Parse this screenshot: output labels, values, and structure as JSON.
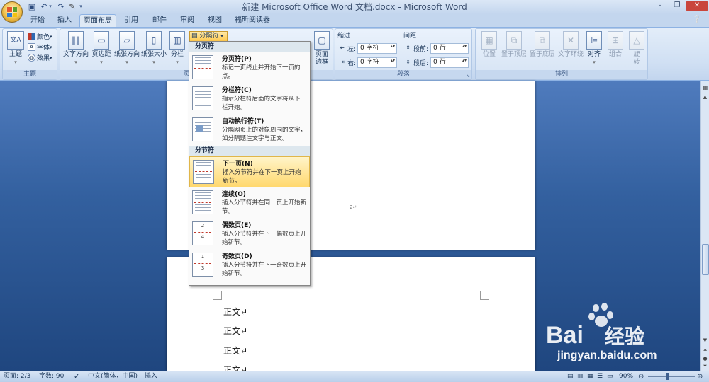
{
  "window": {
    "title": "新建 Microsoft Office Word 文档.docx - Microsoft Word",
    "controls": [
      "–",
      "❐",
      "✕"
    ]
  },
  "tabs": [
    {
      "label": "开始"
    },
    {
      "label": "插入"
    },
    {
      "label": "页面布局",
      "active": true
    },
    {
      "label": "引用"
    },
    {
      "label": "邮件"
    },
    {
      "label": "审阅"
    },
    {
      "label": "视图"
    },
    {
      "label": "福昕阅读器"
    }
  ],
  "ribbon": {
    "themes": {
      "label": "主题",
      "theme_button": "主题",
      "colors": "颜色",
      "fonts": "字体",
      "effects": "效果"
    },
    "page_setup": {
      "label": "页面设置",
      "text_direction": "文字方向",
      "margins": "页边距",
      "orientation": "纸张方向",
      "size": "纸张大小",
      "columns": "分栏",
      "breaks": "分隔符",
      "page_border": "页面边框"
    },
    "paragraph": {
      "label": "段落",
      "indent_title": "缩进",
      "spacing_title": "间距",
      "indent_left_label": "左:",
      "indent_left_value": "0 字符",
      "indent_right_label": "右:",
      "indent_right_value": "0 字符",
      "spacing_before_label": "段前:",
      "spacing_before_value": "0 行",
      "spacing_after_label": "段后:",
      "spacing_after_value": "0 行"
    },
    "arrange": {
      "label": "排列",
      "position": "位置",
      "bring_front": "置于顶层",
      "send_back": "置于底层",
      "text_wrap": "文字环绕",
      "align": "对齐",
      "group": "组合",
      "rotate": "旋转"
    }
  },
  "breaks_menu": {
    "page_breaks_header": "分页符",
    "section_breaks_header": "分节符",
    "items": [
      {
        "title": "分页符(P)",
        "desc": "标记一页终止并开始下一页的点。"
      },
      {
        "title": "分栏符(C)",
        "desc": "指示分栏符后面的文字将从下一栏开始。"
      },
      {
        "title": "自动换行符(T)",
        "desc": "分隔网页上的对象周围的文字，如分隔题注文字与正文。"
      },
      {
        "title": "下一页(N)",
        "desc": "插入分节符并在下一页上开始新节。",
        "highlighted": true
      },
      {
        "title": "连续(O)",
        "desc": "插入分节符并在同一页上开始新节。"
      },
      {
        "title": "偶数页(E)",
        "desc": "插入分节符并在下一偶数页上开始新节。",
        "icon_numbers": [
          "2",
          "4"
        ]
      },
      {
        "title": "奇数页(D)",
        "desc": "插入分节符并在下一奇数页上开始新节。",
        "icon_numbers": [
          "1",
          "3"
        ]
      }
    ]
  },
  "document": {
    "page_number_mark": "2↵",
    "paragraphs": [
      "正文↵",
      "正文↵",
      "正文↵",
      "正文↵"
    ]
  },
  "status_bar": {
    "page": "页面: 2/3",
    "words": "字数: 90",
    "language": "中文(简体，中国)",
    "mode": "插入",
    "zoom": "90%"
  },
  "watermark": {
    "brand": "Bai",
    "brand_cn": "经验",
    "url": "jingyan.baidu.com"
  },
  "colors": {
    "ribbon_bg": "#cfdff3",
    "highlight": "#ffd86e",
    "workspace": "#33609f"
  }
}
